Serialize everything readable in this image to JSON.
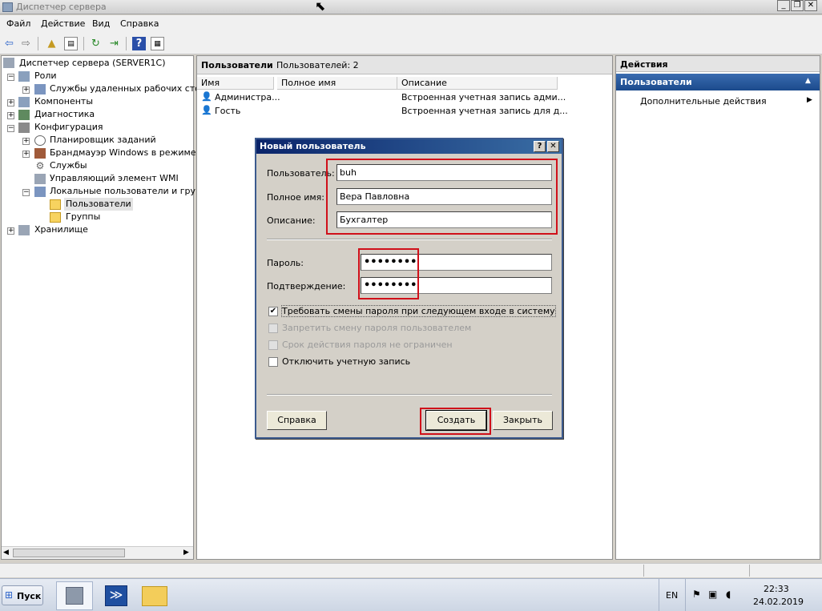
{
  "window": {
    "title": "Диспетчер сервера"
  },
  "menu": [
    "Файл",
    "Действие",
    "Вид",
    "Справка"
  ],
  "toolbar": {
    "icons": [
      "back-icon",
      "forward-icon",
      "up-folder-icon",
      "show-tree-icon",
      "refresh-icon",
      "export-icon",
      "help-icon",
      "properties-icon"
    ]
  },
  "tree": {
    "root": "Диспетчер сервера (SERVER1C)",
    "roles": "Роли",
    "rds": "Службы удаленных рабочих столо",
    "components": "Компоненты",
    "diagnostics": "Диагностика",
    "configuration": "Конфигурация",
    "scheduler": "Планировщик заданий",
    "firewall": "Брандмауэр Windows в режиме пов",
    "services": "Службы",
    "wmi": "Управляющий элемент WMI",
    "local_users": "Локальные пользователи и группь",
    "users": "Пользователи",
    "groups": "Группы",
    "storage": "Хранилище"
  },
  "list": {
    "title": "Пользователи",
    "count": "Пользователей: 2",
    "columns": [
      "Имя",
      "Полное имя",
      "Описание"
    ],
    "rows": [
      {
        "name": "Администра...",
        "fullname": "",
        "description": "Встроенная учетная запись адми..."
      },
      {
        "name": "Гость",
        "fullname": "",
        "description": "Встроенная учетная запись для д..."
      }
    ]
  },
  "actions": {
    "title": "Действия",
    "section": "Пользователи",
    "more": "Дополнительные действия"
  },
  "dialog": {
    "title": "Новый пользователь",
    "help_glyph": "?",
    "close_glyph": "✕",
    "username_label": "Пользователь:",
    "username_value": "buh",
    "fullname_label": "Полное имя:",
    "fullname_value": "Вера Павловна",
    "description_label": "Описание:",
    "description_value": "Бухгалтер",
    "password_label": "Пароль:",
    "password_value": "••••••••",
    "confirm_label": "Подтверждение:",
    "confirm_value": "••••••••",
    "opt_change_pwd": "Требовать смены пароля при следующем входе в систему",
    "opt_change_pwd_checked": true,
    "opt_forbid_change": "Запретить смену пароля пользователем",
    "opt_never_expire": "Срок действия пароля не ограничен",
    "opt_disable": "Отключить учетную запись",
    "help_button": "Справка",
    "create_button": "Создать",
    "close_button": "Закрыть"
  },
  "taskbar": {
    "start": "Пуск",
    "lang": "EN",
    "time": "22:33",
    "date": "24.02.2019"
  },
  "colors": {
    "highlight": "#d0101a",
    "titlebar": "#0a246a",
    "actions_header": "#1b4a8c"
  }
}
